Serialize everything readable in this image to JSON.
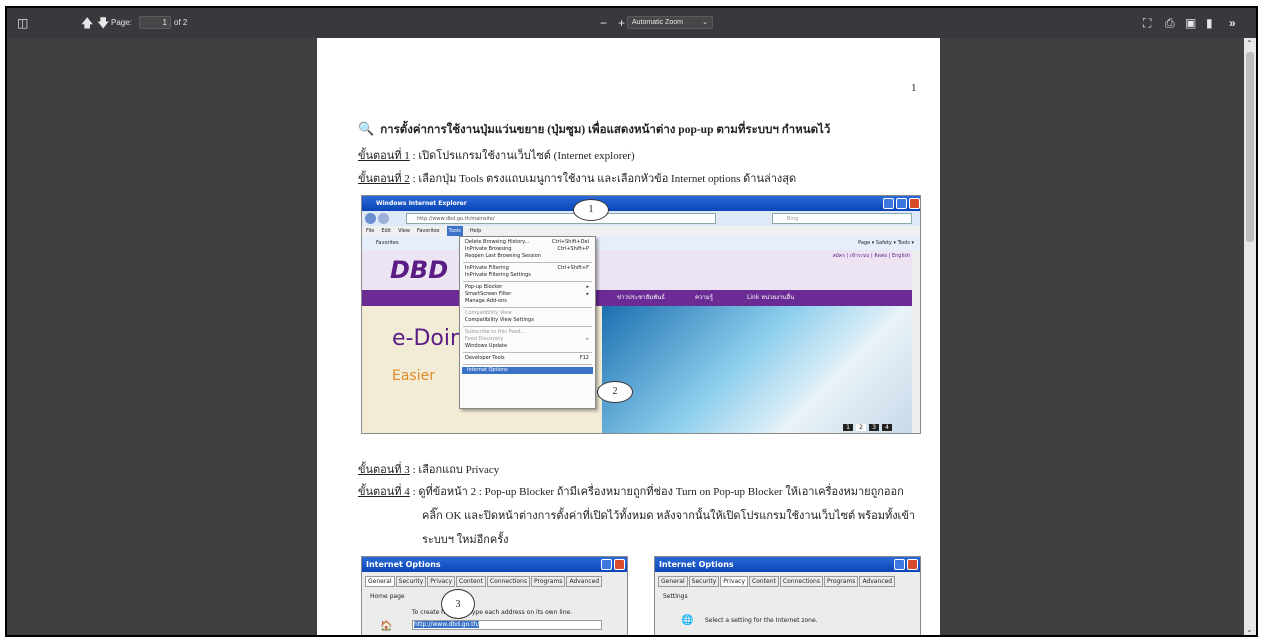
{
  "toolbar": {
    "page_label": "Page:",
    "page_value": "1",
    "page_of": "of 2",
    "zoom_minus": "−",
    "zoom_plus": "+",
    "zoom_value": "Automatic Zoom"
  },
  "doc": {
    "page_number": "1",
    "heading": "การตั้งค่าการใช้งานปุ่มแว่นขยาย (ปุ่มซูม) เพื่อแสดงหน้าต่าง pop-up ตามที่ระบบฯ กำหนดไว้",
    "step1_label": "ขั้นตอนที่ 1",
    "step1_text": " : เปิดโปรแกรมใช้งานเว็บไซต์ (Internet explorer)",
    "step2_label": "ขั้นตอนที่ 2",
    "step2_text": " : เลือกปุ่ม Tools ตรงแถบเมนูการใช้งาน และเลือกหัวข้อ Internet options ด้านล่างสุด",
    "step3_label": "ขั้นตอนที่ 3",
    "step3_text": " : เลือกแถบ Privacy",
    "step4_label": "ขั้นตอนที่ 4",
    "step4_text": " : ดูที่ข้อหน้า 2 : Pop-up Blocker ถ้ามีเครื่องหมายถูกที่ช่อง Turn on Pop-up Blocker ให้เอาเครื่องหมายถูกออก",
    "step4_line2": "คลิ๊ก OK และปิดหน้าต่างการตั้งค่าที่เปิดไว้ทั้งหมด หลังจากนั้นให้เปิดโปรแกรมใช้งานเว็บไซต์ พร้อมทั้งเข้า",
    "step4_line3": "ระบบฯ ใหม่อีกครั้ง"
  },
  "ie": {
    "title": "Windows Internet Explorer",
    "address": "http://www.dbd.go.th/mainsite/",
    "search": "Bing",
    "menubar": [
      "File",
      "Edit",
      "View",
      "Favorites",
      "Tools",
      "Help"
    ],
    "favorites": "Favorites",
    "command_bar": "Page ▾  Safety ▾  Tools ▾",
    "menu_items": [
      {
        "label": "Delete Browsing History...",
        "shortcut": "Ctrl+Shift+Del"
      },
      {
        "label": "InPrivate Browsing",
        "shortcut": "Ctrl+Shift+P"
      },
      {
        "label": "Reopen Last Browsing Session",
        "shortcut": ""
      },
      {
        "label": "InPrivate Filtering",
        "shortcut": "Ctrl+Shift+F"
      },
      {
        "label": "InPrivate Filtering Settings",
        "shortcut": ""
      },
      {
        "label": "Pop-up Blocker",
        "shortcut": "▸"
      },
      {
        "label": "SmartScreen Filter",
        "shortcut": "▸"
      },
      {
        "label": "Manage Add-ons",
        "shortcut": ""
      },
      {
        "label": "Compatibility View",
        "shortcut": ""
      },
      {
        "label": "Compatibility View Settings",
        "shortcut": ""
      },
      {
        "label": "Subscribe to this Feed...",
        "shortcut": ""
      },
      {
        "label": "Feed Discovery",
        "shortcut": "▸"
      },
      {
        "label": "Windows Update",
        "shortcut": ""
      },
      {
        "label": "Developer Tools",
        "shortcut": "F12"
      },
      {
        "label": "Internet Options",
        "shortcut": ""
      }
    ],
    "site_nav": [
      "ข่าวประชาสัมพันธ์",
      "ความรู้",
      "Link หน่วยงานอื่น"
    ],
    "site_logo": "DBD",
    "edoing": "e-Doin",
    "easier": "Easier",
    "site_top": "สมัคร | เข้าระบบ | ติดต่อ | English",
    "slides": [
      "1",
      "2",
      "3",
      "4"
    ]
  },
  "callouts": [
    "1",
    "2",
    "3"
  ],
  "dialog_left": {
    "title": "Internet Options",
    "tabs": [
      "General",
      "Security",
      "Privacy",
      "Content",
      "Connections",
      "Programs",
      "Advanced"
    ],
    "group": "Home page",
    "text": "To create home pa      type each address on its own line.",
    "url": "http://www.dbd.go.th/"
  },
  "dialog_right": {
    "title": "Internet Options",
    "tabs": [
      "General",
      "Security",
      "Privacy",
      "Content",
      "Connections",
      "Programs",
      "Advanced"
    ],
    "group": "Settings",
    "text": "Select a setting for the Internet zone."
  }
}
